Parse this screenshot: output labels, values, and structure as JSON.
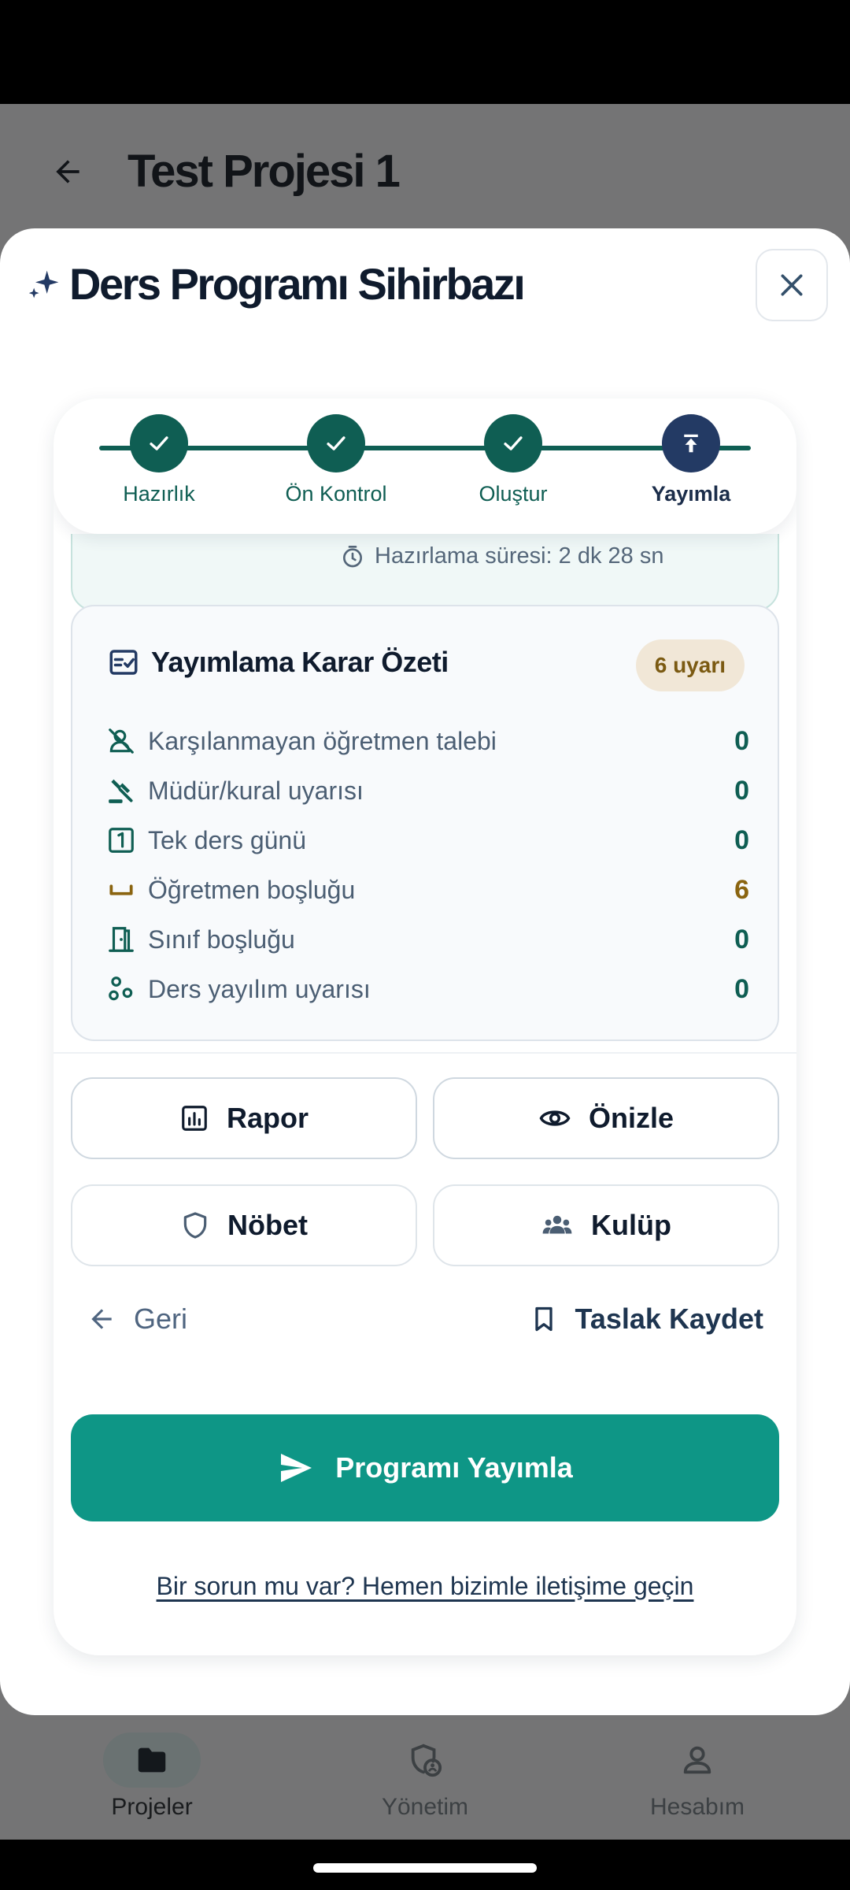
{
  "app": {
    "title": "Test Projesi 1"
  },
  "sheet": {
    "title": "Ders Programı Sihirbazı"
  },
  "stepper": {
    "steps": [
      {
        "label": "Hazırlık",
        "state": "done"
      },
      {
        "label": "Ön Kontrol",
        "state": "done"
      },
      {
        "label": "Oluştur",
        "state": "done"
      },
      {
        "label": "Yayımla",
        "state": "current"
      }
    ]
  },
  "prep": {
    "duration_text": "Hazırlama süresi: 2 dk 28 sn"
  },
  "summary": {
    "title": "Yayımlama Karar Özeti",
    "badge": "6 uyarı",
    "metrics": [
      {
        "label": "Karşılanmayan öğretmen talebi",
        "value": "0",
        "icon": "user-off-icon"
      },
      {
        "label": "Müdür/kural uyarısı",
        "value": "0",
        "icon": "gavel-icon"
      },
      {
        "label": "Tek ders günü",
        "value": "0",
        "icon": "looks-one-icon"
      },
      {
        "label": "Öğretmen boşluğu",
        "value": "6",
        "icon": "space-bar-icon"
      },
      {
        "label": "Sınıf boşluğu",
        "value": "0",
        "icon": "door-open-icon"
      },
      {
        "label": "Ders yayılım uyarısı",
        "value": "0",
        "icon": "scatter-icon"
      }
    ]
  },
  "actions": {
    "report": "Rapor",
    "preview": "Önizle",
    "duty": "Nöbet",
    "club": "Kulüp",
    "back": "Geri",
    "save_draft": "Taslak Kaydet",
    "publish": "Programı Yayımla",
    "help_link": "Bir sorun mu var? Hemen bizimle iletişime geçin"
  },
  "bottom_nav": {
    "items": [
      {
        "label": "Projeler",
        "active": true
      },
      {
        "label": "Yönetim",
        "active": false
      },
      {
        "label": "Hesabım",
        "active": false
      }
    ]
  },
  "colors": {
    "accent": "#0e9686",
    "step_done": "#0f5e53",
    "step_current": "#233a64",
    "warning": "#8a6410"
  }
}
